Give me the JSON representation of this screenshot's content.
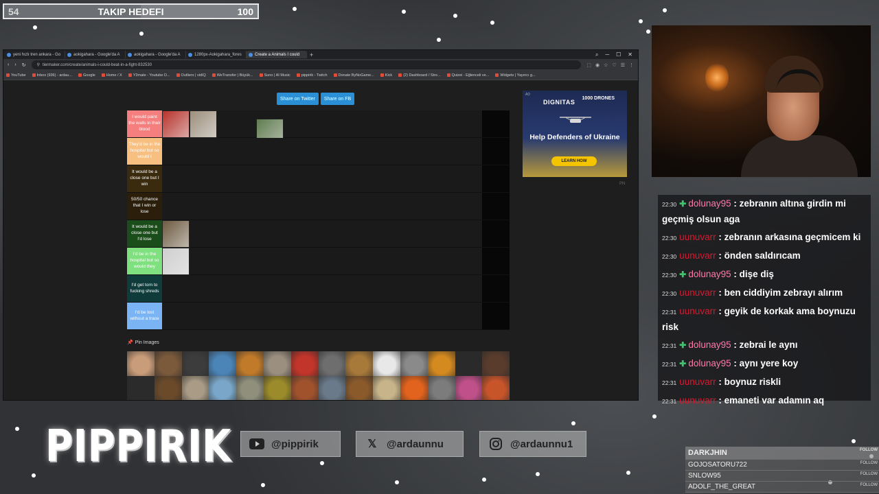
{
  "goal": {
    "current": "54",
    "title": "TAKIP HEDEFI",
    "max": "100",
    "progress": 0.54
  },
  "browser": {
    "tabs": [
      {
        "label": "yeni hızlı tren ankara - Go"
      },
      {
        "label": "aokigahara - Google'da A"
      },
      {
        "label": "aokigahara - Google'da A"
      },
      {
        "label": "1280px-Aokigahara_fores"
      },
      {
        "label": "Create a Animals I could"
      }
    ],
    "url": "tiermaker.com/create/animals-i-could-beat-in-a-fight-832530",
    "bookmarks": [
      "YouTube",
      "Inbox (936) - ardau...",
      "Google",
      "Home / X",
      "Y2mate - Youtube D...",
      "Outliers | vidIQ",
      "WeTransfer | Büyük...",
      "Suno | AI Music",
      "pippirik - Twitch",
      "Donate ByNoGame...",
      "Kick",
      "(2) Dashboard / Stre...",
      "Quizei - Eğlenceli ve...",
      "Widgets | Yayıncı g..."
    ]
  },
  "tiermaker": {
    "share_twitter": "Share on Twitter",
    "share_fb": "Share on FB",
    "pin_label": "Pin Images",
    "tiers": [
      {
        "label": "I would paint the walls in their blood",
        "color": "#f57f7f",
        "items": [
          "#b8322a",
          "#9c8f7c"
        ]
      },
      {
        "label": "They'd be in the hospital but so would I",
        "color": "#f7bf80",
        "items": []
      },
      {
        "label": "It would be a close one but I win",
        "color": "#3a2a0e",
        "items": []
      },
      {
        "label": "50/50 chance that I win or lose",
        "color": "#2b1f0c",
        "items": []
      },
      {
        "label": "It would be a close one but I'd lose",
        "color": "#1b4d1a",
        "items": [
          "#6d5a40"
        ]
      },
      {
        "label": "I'd be in the hospital but so would they",
        "color": "#7fe07f",
        "items": [
          "#cfcfcf"
        ]
      },
      {
        "label": "I'd get torn to fucking shreds",
        "color": "#0f3b3b",
        "items": []
      },
      {
        "label": "I'd be lost without a trace",
        "color": "#7ab4f5",
        "items": []
      }
    ],
    "dragging": {
      "color": "#6b8e5a"
    },
    "pool": [
      "#c99c7a",
      "#7b5a3c",
      "#3c3c3c",
      "#4b85b8",
      "#c07a2a",
      "#9b8f80",
      "#c2352a",
      "#6e6e6e",
      "#a87a3a",
      "#e8e8e8",
      "#8a8a8a",
      "#d58a1f",
      "#2a2a2a",
      "#5a3c2c",
      "#2b2b2b",
      "#6b4a2a",
      "#a99b85",
      "#7aa7c9",
      "#8f8f7c",
      "#9c8b2a",
      "#a0522d",
      "#6a7a8a",
      "#8b5a2b",
      "#c8b48a",
      "#e2631d",
      "#7c7c7c",
      "#c0508a",
      "#c8552a"
    ],
    "ad": {
      "label": "AD",
      "brand": "DIGNITAS",
      "drones": "1000 DRONES",
      "headline": "Help Defenders of Ukraine",
      "cta": "LEARN HOW",
      "footer": "PN"
    }
  },
  "chat": [
    {
      "time": "22:30",
      "badge": true,
      "user": "dolunay95",
      "user_style": "user1",
      "text": " : zebranın altına girdin mi geçmiş olsun aga"
    },
    {
      "time": "22:30",
      "badge": false,
      "user": "uunuvarr",
      "user_style": "user2",
      "text": " : zebranın arkasına geçmicem ki"
    },
    {
      "time": "22:30",
      "badge": false,
      "user": "uunuvarr",
      "user_style": "user2",
      "text": " : önden saldırıcam"
    },
    {
      "time": "22:30",
      "badge": true,
      "user": "dolunay95",
      "user_style": "user1",
      "text": " : dişe diş"
    },
    {
      "time": "22:30",
      "badge": false,
      "user": "uunuvarr",
      "user_style": "user2",
      "text": " : ben ciddiyim zebrayı alırım"
    },
    {
      "time": "22:31",
      "badge": false,
      "user": "uunuvarr",
      "user_style": "user2",
      "text": " : geyik de korkak ama boynuzu risk"
    },
    {
      "time": "22:31",
      "badge": true,
      "user": "dolunay95",
      "user_style": "user1",
      "text": " : zebrai le aynı"
    },
    {
      "time": "22:31",
      "badge": true,
      "user": "dolunay95",
      "user_style": "user1",
      "text": " : aynı yere koy"
    },
    {
      "time": "22:31",
      "badge": false,
      "user": "uunuvarr",
      "user_style": "user2",
      "text": " : boynuz riskli"
    },
    {
      "time": "22:31",
      "badge": false,
      "user": "uunuvarr",
      "user_style": "user2",
      "text": " : emaneti var adamın aq"
    }
  ],
  "logo": "PIPPIRIK",
  "socials": [
    {
      "icon": "youtube-icon",
      "handle": "@pippirik"
    },
    {
      "icon": "x-icon",
      "handle": "@ardaunnu"
    },
    {
      "icon": "instagram-icon",
      "handle": "@ardaunnu1"
    }
  ],
  "followers": {
    "follow_label": "FOLLOW",
    "names": [
      "DARKJHIN",
      "GOJOSATORU722",
      "SNLOW95",
      "ADOLF_THE_GREAT"
    ]
  }
}
